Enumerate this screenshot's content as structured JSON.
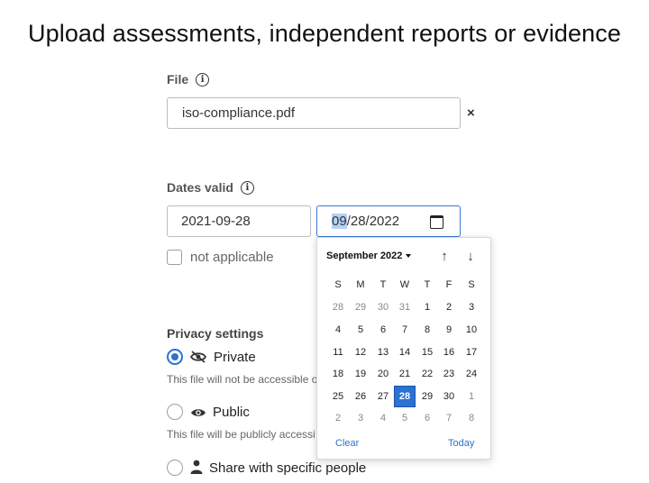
{
  "page_title": "Upload assessments, independent reports or evidence",
  "file": {
    "label": "File",
    "info_icon": "info-icon",
    "value": "iso-compliance.pdf",
    "clear_glyph": "×"
  },
  "dates": {
    "label": "Dates valid",
    "start_value": "2021-09-28",
    "end_value_selected": "09",
    "end_value_rest": "/28/2022",
    "not_applicable_label": "not applicable",
    "not_applicable_checked": false
  },
  "privacy": {
    "label": "Privacy settings",
    "options": [
      {
        "label": "Private",
        "icon": "eye-slash-icon",
        "selected": true,
        "description": "This file will not be accessible o"
      },
      {
        "label": "Public",
        "icon": "eye-icon",
        "selected": false,
        "description": "This file will be publicly accessi"
      },
      {
        "label": "Share with specific people",
        "icon": "person-icon",
        "selected": false,
        "description": ""
      }
    ]
  },
  "datepicker": {
    "month_label": "September 2022",
    "weekday_labels": [
      "S",
      "M",
      "T",
      "W",
      "T",
      "F",
      "S"
    ],
    "weeks": [
      [
        "28",
        "29",
        "30",
        "31",
        "1",
        "2",
        "3"
      ],
      [
        "4",
        "5",
        "6",
        "7",
        "8",
        "9",
        "10"
      ],
      [
        "11",
        "12",
        "13",
        "14",
        "15",
        "16",
        "17"
      ],
      [
        "18",
        "19",
        "20",
        "21",
        "22",
        "23",
        "24"
      ],
      [
        "25",
        "26",
        "27",
        "28",
        "29",
        "30",
        "1"
      ],
      [
        "2",
        "3",
        "4",
        "5",
        "6",
        "7",
        "8"
      ]
    ],
    "selected_day": "28",
    "clear_label": "Clear",
    "today_label": "Today",
    "colors": {
      "accent": "#2a72d4",
      "muted": "#888888"
    }
  }
}
